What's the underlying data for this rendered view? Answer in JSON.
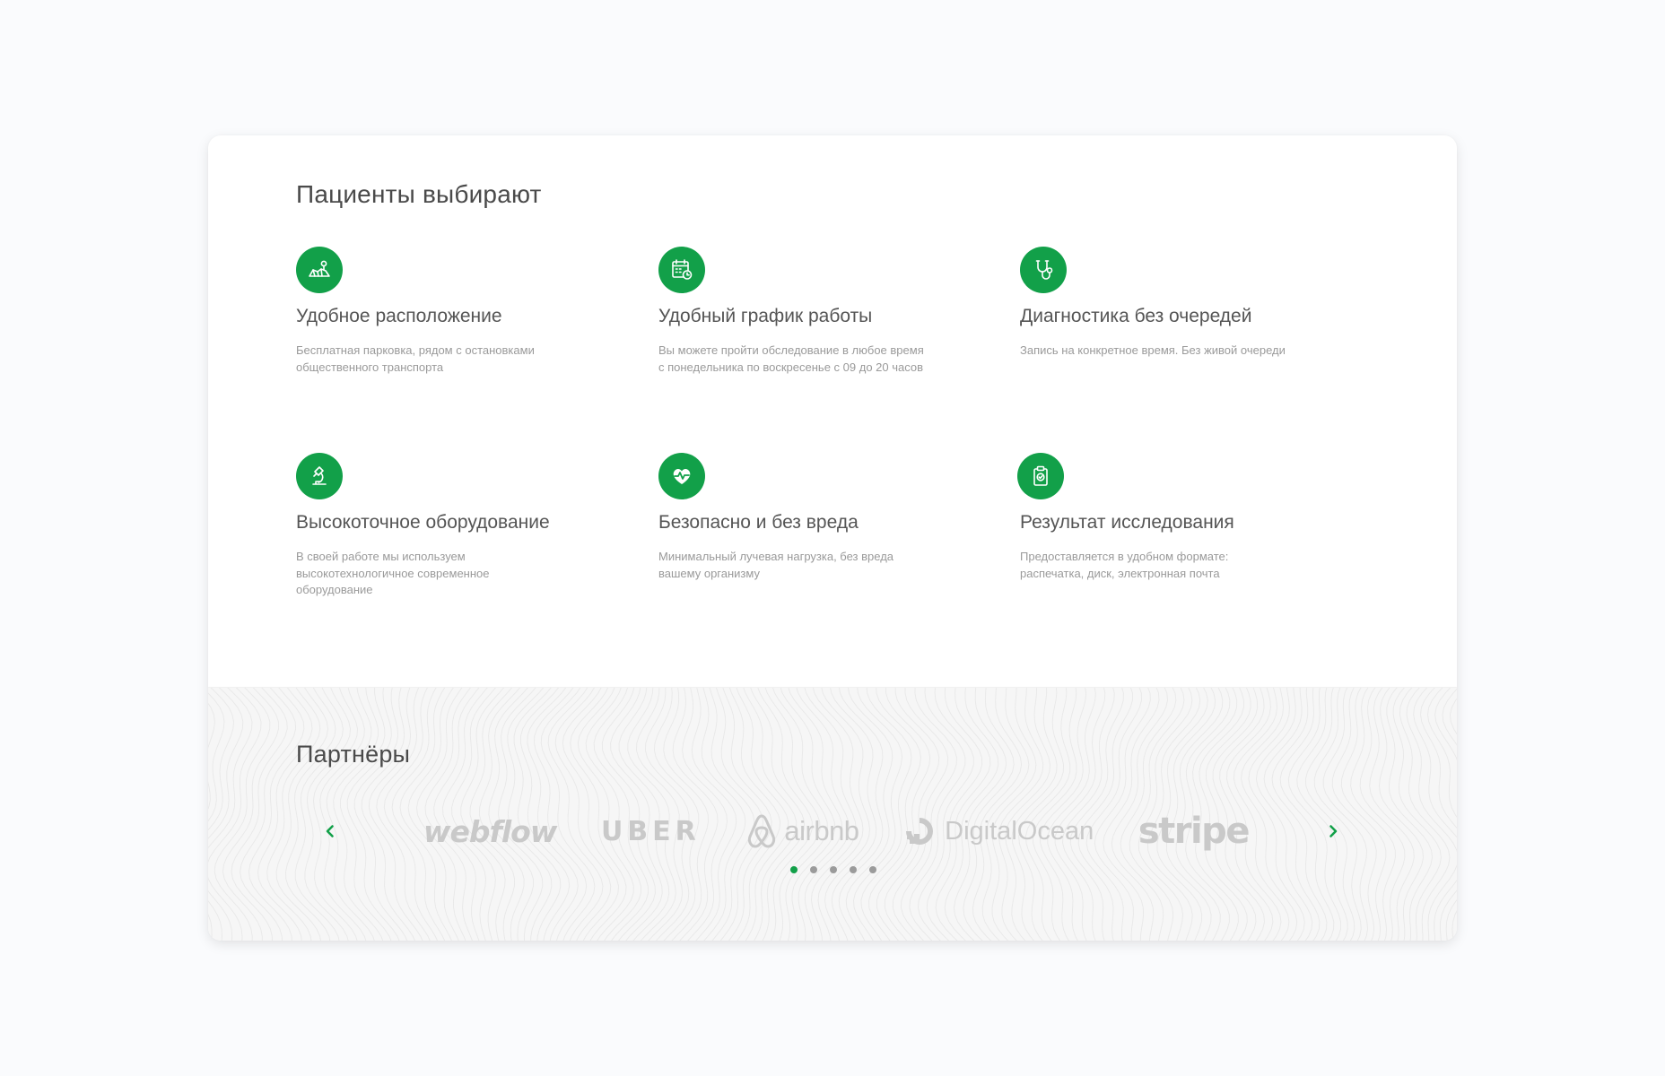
{
  "colors": {
    "accent": "#12a049",
    "logo_gray": "#c9c9c9",
    "text": "#555555",
    "muted": "#9a9a9a"
  },
  "patients": {
    "title": "Пациенты выбирают",
    "features": [
      {
        "icon": "map-pin-icon",
        "title": "Удобное расположение",
        "description": "Бесплатная парковка, рядом с остановками общественного транспорта"
      },
      {
        "icon": "calendar-clock-icon",
        "title": "Удобный график работы",
        "description": "Вы можете пройти обследование в любое время с понедельника по воскресенье с 09 до 20 часов"
      },
      {
        "icon": "stethoscope-icon",
        "title": "Диагностика без очередей",
        "description": "Запись на конкретное время. Без живой очереди"
      },
      {
        "icon": "microscope-icon",
        "title": "Высокоточное оборудование",
        "description": "В своей работе мы используем высокотехнологичное современное оборудование"
      },
      {
        "icon": "heart-pulse-icon",
        "title": "Безопасно и без вреда",
        "description": "Минимальный лучевая нагрузка, без вреда вашему организму"
      },
      {
        "icon": "clipboard-check-icon",
        "title": "Результат исследования",
        "description": "Предоставляется в удобном формате: распечатка, диск, электронная почта"
      }
    ]
  },
  "partners": {
    "title": "Партнёры",
    "prev_icon": "chevron-left-icon",
    "next_icon": "chevron-right-icon",
    "logos": [
      "webflow",
      "UBER",
      "airbnb",
      "DigitalOcean",
      "stripe"
    ],
    "pagination": {
      "total": 5,
      "active": 1
    }
  }
}
